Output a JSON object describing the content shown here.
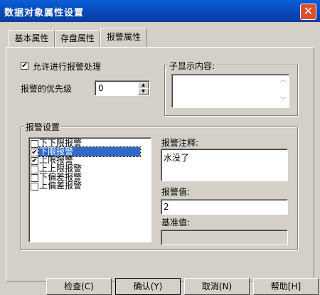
{
  "window": {
    "title": "数据对象属性设置",
    "close_glyph": "✕"
  },
  "tabs": [
    {
      "label": "基本属性"
    },
    {
      "label": "存盘属性"
    },
    {
      "label": "报警属性"
    }
  ],
  "allow_alarm": {
    "label": "允许进行报警处理",
    "checked": true,
    "mark": "✔"
  },
  "priority": {
    "label": "报警的优先级",
    "value": "0",
    "up": "▲",
    "down": "▼"
  },
  "sub_display": {
    "label": "子显示内容:",
    "scroll_up": "︿",
    "scroll_down": "﹀"
  },
  "alarm_settings": {
    "label": "报警设置",
    "items": [
      {
        "label": "下下限报警",
        "checked": false,
        "mark": ""
      },
      {
        "label": "下限报警",
        "checked": true,
        "mark": "✔"
      },
      {
        "label": "上限报警",
        "checked": true,
        "mark": "✔"
      },
      {
        "label": "上上限报警",
        "checked": false,
        "mark": ""
      },
      {
        "label": "下偏差报警",
        "checked": false,
        "mark": ""
      },
      {
        "label": "上偏差报警",
        "checked": false,
        "mark": ""
      }
    ]
  },
  "alarm_note": {
    "label": "报警注释:",
    "value": "水没了"
  },
  "alarm_value": {
    "label": "报警值:",
    "value": "2"
  },
  "base_value": {
    "label": "基准值:",
    "value": ""
  },
  "buttons": {
    "check": "检查(C)",
    "confirm": "确认(Y)",
    "cancel": "取消(N)",
    "help": "帮助[H]"
  },
  "colors": {
    "titlebar": "#0a5fd8",
    "selection": "#316ac5",
    "dialog": "#d4d0c8"
  }
}
